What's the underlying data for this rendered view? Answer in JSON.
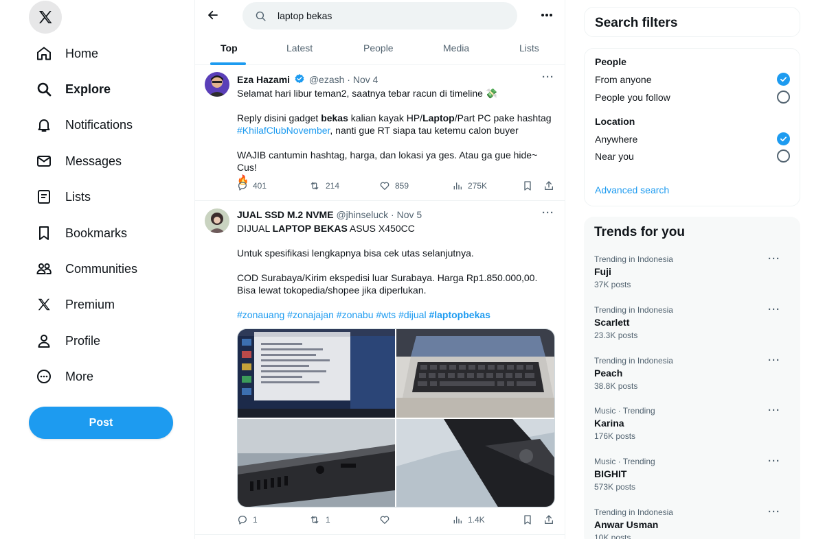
{
  "nav": {
    "home": "Home",
    "explore": "Explore",
    "notifications": "Notifications",
    "messages": "Messages",
    "lists": "Lists",
    "bookmarks": "Bookmarks",
    "communities": "Communities",
    "premium": "Premium",
    "profile": "Profile",
    "more": "More",
    "post": "Post"
  },
  "search": {
    "query": "laptop bekas"
  },
  "tabs": [
    "Top",
    "Latest",
    "People",
    "Media",
    "Lists"
  ],
  "tweets": [
    {
      "name": "Eza Hazami",
      "handle": "@ezash",
      "sep": "·",
      "date": "Nov 4",
      "line1": "Selamat hari libur teman2, saatnya tebar racun di timeline 💸",
      "p2a": "Reply disini gadget ",
      "p2b": "bekas",
      "p2c": " kalian kayak HP/",
      "p2d": "Laptop",
      "p2e": "/Part PC pake hashtag",
      "p2tag": "#KhilafClubNovember",
      "p2f": ", nanti gue RT siapa tau ketemu calon buyer",
      "p3": "WAJIB cantumin hashtag, harga, dan lokasi ya ges. Atau ga gue hide~  Cus!",
      "p3emoji": "🔥",
      "replies": "401",
      "retweets": "214",
      "likes": "859",
      "views": "275K"
    },
    {
      "name": "JUAL SSD M.2 NVME",
      "handle": "@jhinseluck",
      "sep": "·",
      "date": "Nov 5",
      "l1a": "DIJUAL ",
      "l1b": "LAPTOP BEKAS",
      "l1c": " ASUS X450CC",
      "p2": "Untuk spesifikasi lengkapnya bisa cek utas selanjutnya.",
      "p3": "COD Surabaya/Kirim ekspedisi luar Surabaya. Harga Rp1.850.000,00. Bisa lewat tokopedia/shopee jika diperlukan.",
      "tags": "#zonauang #zonajajan #zonabu #wts #dijual ",
      "tagbold": "#laptopbekas",
      "replies": "1",
      "retweets": "1",
      "likes": "",
      "views": "1.4K"
    }
  ],
  "filters": {
    "title": "Search filters",
    "people": "People",
    "from_anyone": "From anyone",
    "people_you_follow": "People you follow",
    "location": "Location",
    "anywhere": "Anywhere",
    "near_you": "Near you",
    "advanced": "Advanced search"
  },
  "trends": {
    "title": "Trends for you",
    "items": [
      {
        "context": "Trending in Indonesia",
        "name": "Fuji",
        "count": "37K posts"
      },
      {
        "context": "Trending in Indonesia",
        "name": "Scarlett",
        "count": "23.3K posts"
      },
      {
        "context": "Trending in Indonesia",
        "name": "Peach",
        "count": "38.8K posts"
      },
      {
        "context": "Music · Trending",
        "name": "Karina",
        "count": "176K posts"
      },
      {
        "context": "Music · Trending",
        "name": "BIGHIT",
        "count": "573K posts"
      },
      {
        "context": "Trending in Indonesia",
        "name": "Anwar Usman",
        "count": "10K posts"
      }
    ]
  },
  "colors": {
    "accent": "#1d9bf0",
    "text": "#0f1419",
    "muted": "#536471",
    "border": "#eff3f4"
  }
}
